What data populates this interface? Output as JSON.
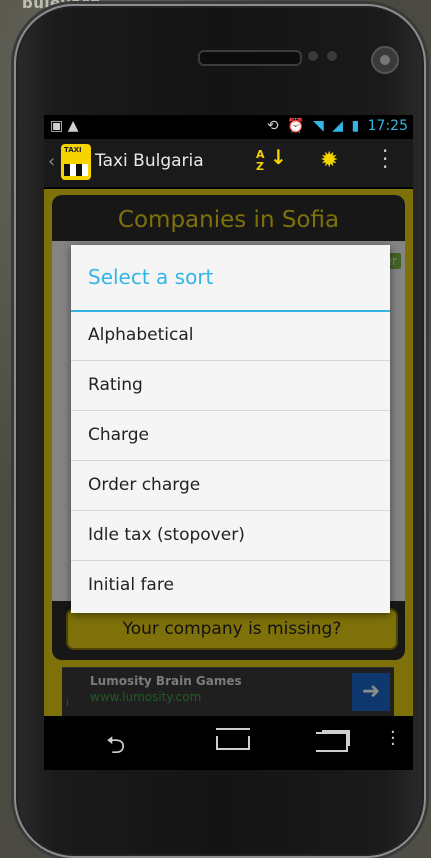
{
  "background": {
    "street_text": "bulevard"
  },
  "statusbar": {
    "time": "17:25"
  },
  "actionbar": {
    "app_title": "Taxi Bulgaria",
    "sort_label": "A Z",
    "app_icon_text": "TAXI"
  },
  "content": {
    "title": "Companies in Sofia",
    "missing_button": "Your company is missing?",
    "filter_tag": "er"
  },
  "ad": {
    "title": "Lumosity Brain Games",
    "url": "www.lumosity.com",
    "info": "i"
  },
  "dialog": {
    "title": "Select a sort",
    "options": [
      {
        "label": "Alphabetical"
      },
      {
        "label": "Rating"
      },
      {
        "label": "Charge"
      },
      {
        "label": "Order charge"
      },
      {
        "label": "Idle tax (stopover)"
      },
      {
        "label": "Initial fare"
      }
    ]
  },
  "colors": {
    "accent": "#33b5e5",
    "taxi_yellow": "#e7ce12"
  }
}
